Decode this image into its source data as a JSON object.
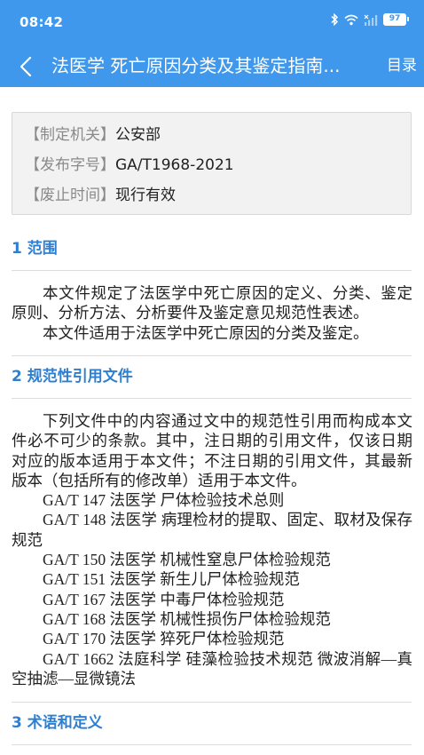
{
  "status_bar": {
    "time": "08:42",
    "battery": "97",
    "icons": [
      "bluetooth-icon",
      "wifi-icon",
      "signal-icon",
      "battery-icon"
    ]
  },
  "app_bar": {
    "title": "法医学 死亡原因分类及其鉴定指南...",
    "toc_label": "目录",
    "background": "#3f98ec"
  },
  "meta": {
    "rows": [
      {
        "label": "【制定机关】",
        "value": "公安部"
      },
      {
        "label": "【发布字号】",
        "value": "GA/T1968-2021"
      },
      {
        "label": "【废止时间】",
        "value": "现行有效"
      }
    ]
  },
  "sections": [
    {
      "heading": "1 范围",
      "paragraphs": [
        "本文件规定了法医学中死亡原因的定义、分类、鉴定原则、分析方法、分析要件及鉴定意见规范性表述。",
        "本文件适用于法医学中死亡原因的分类及鉴定。"
      ]
    },
    {
      "heading": "2 规范性引用文件",
      "paragraphs": [
        "下列文件中的内容通过文中的规范性引用而构成本文件必不可少的条款。其中，注日期的引用文件，仅该日期对应的版本适用于本文件；不注日期的引用文件，其最新版本（包括所有的修改单）适用于本文件。",
        "GA/T 147 法医学 尸体检验技术总则",
        "GA/T 148 法医学 病理检材的提取、固定、取材及保存规范",
        "GA/T 150 法医学 机械性窒息尸体检验规范",
        "GA/T 151 法医学 新生儿尸体检验规范",
        "GA/T 167 法医学 中毒尸体检验规范",
        "GA/T 168 法医学 机械性损伤尸体检验规范",
        "GA/T 170 法医学 猝死尸体检验规范",
        "GA/T 1662 法庭科学 硅藻检验技术规范 微波消解—真空抽滤—显微镜法"
      ]
    },
    {
      "heading": "3 术语和定义",
      "paragraphs": []
    }
  ]
}
